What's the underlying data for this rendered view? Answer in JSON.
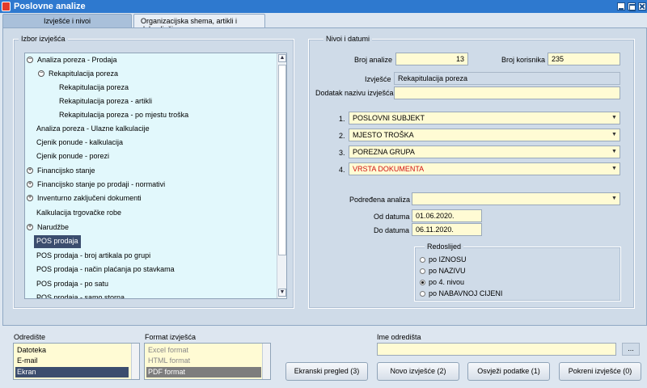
{
  "window": {
    "title": "Poslovne analize"
  },
  "tabs": [
    {
      "label": "Izvješće i nivoi"
    },
    {
      "label": "Organizacijska shema, artikli i dobavljači"
    }
  ],
  "left_group": {
    "title": "Izbor izvješća"
  },
  "tree": {
    "items": [
      {
        "label": "Analiza poreza - Prodaja",
        "toggle": "−"
      },
      {
        "label": "Rekapitulacija poreza",
        "toggle": "−"
      },
      {
        "label": "Rekapitulacija poreza"
      },
      {
        "label": "Rekapitulacija poreza - artikli"
      },
      {
        "label": "Rekapitulacija poreza - po mjestu troška"
      },
      {
        "label": "Analiza poreza - Ulazne kalkulacije"
      },
      {
        "label": "Cjenik ponude - kalkulacija"
      },
      {
        "label": "Cjenik ponude - porezi"
      },
      {
        "label": "Financijsko stanje",
        "toggle": "+"
      },
      {
        "label": "Financijsko stanje po prodaji - normativi",
        "toggle": "+"
      },
      {
        "label": "Inventurno zaključeni dokumenti",
        "toggle": "+"
      },
      {
        "label": "Kalkulacija trgovačke robe"
      },
      {
        "label": "Narudžbe",
        "toggle": "+"
      },
      {
        "label": "POS prodaja"
      },
      {
        "label": "POS prodaja - broj artikala po grupi"
      },
      {
        "label": "POS prodaja - način plaćanja po stavkama"
      },
      {
        "label": "POS prodaja - po satu"
      },
      {
        "label": "POS prodaja - samo storna"
      }
    ]
  },
  "right_group": {
    "title": "Nivoi i datumi"
  },
  "form": {
    "broj_analize_label": "Broj analize",
    "broj_analize_value": "13",
    "broj_korisnika_label": "Broj  korisnika",
    "broj_korisnika_value": "235",
    "izvjesce_label": "Izvješće",
    "izvjesce_value": "Rekapitulacija poreza",
    "dodatak_label": "Dodatak nazivu izvješća",
    "dodatak_value": "",
    "levels": [
      {
        "num": "1.",
        "value": "POSLOVNI SUBJEKT"
      },
      {
        "num": "2.",
        "value": "MJESTO TROŠKA"
      },
      {
        "num": "3.",
        "value": "POREZNA GRUPA"
      },
      {
        "num": "4.",
        "value": "VRSTA DOKUMENTA"
      }
    ],
    "podredena_label": "Podređena analiza",
    "podredena_value": "",
    "od_datuma_label": "Od datuma",
    "od_datuma_value": "01.06.2020.",
    "do_datuma_label": "Do datuma",
    "do_datuma_value": "06.11.2020."
  },
  "sort": {
    "title": "Redoslijed",
    "options": [
      {
        "label": "po IZNOSU"
      },
      {
        "label": "po NAZIVU"
      },
      {
        "label": "po 4. nivou"
      },
      {
        "label": "po NABAVNOJ CIJENI"
      }
    ],
    "selected_index": 2
  },
  "bottom": {
    "odrediste_label": "Odredište",
    "odrediste_items": [
      {
        "label": "Datoteka"
      },
      {
        "label": "E-mail"
      },
      {
        "label": "Ekran"
      }
    ],
    "format_label": "Format izvješća",
    "format_items": [
      {
        "label": "Excel format"
      },
      {
        "label": "HTML format"
      },
      {
        "label": "PDF format"
      }
    ],
    "ime_label": "Ime odredišta",
    "ime_value": "",
    "browse_label": "...",
    "buttons": [
      {
        "label": "Ekranski pregled (3)"
      },
      {
        "label": "Novo izvješće (2)"
      },
      {
        "label": "Osvježi podatke (1)"
      },
      {
        "label": "Pokreni izvješće (0)"
      }
    ]
  },
  "colors": {
    "titlebar": "#2e79cf",
    "panel": "#cfdbe8",
    "field": "#fffbd4",
    "tree_bg": "#e2f8fc",
    "selection": "#3b4d6e",
    "level4_text": "#d01212"
  },
  "icons": {
    "app": "app-icon",
    "minimize": "minimize-icon",
    "maximize": "maximize-icon",
    "close": "close-icon",
    "dropdown": "chevron-down-icon",
    "expand": "plus-circle-icon",
    "collapse": "minus-circle-icon"
  }
}
